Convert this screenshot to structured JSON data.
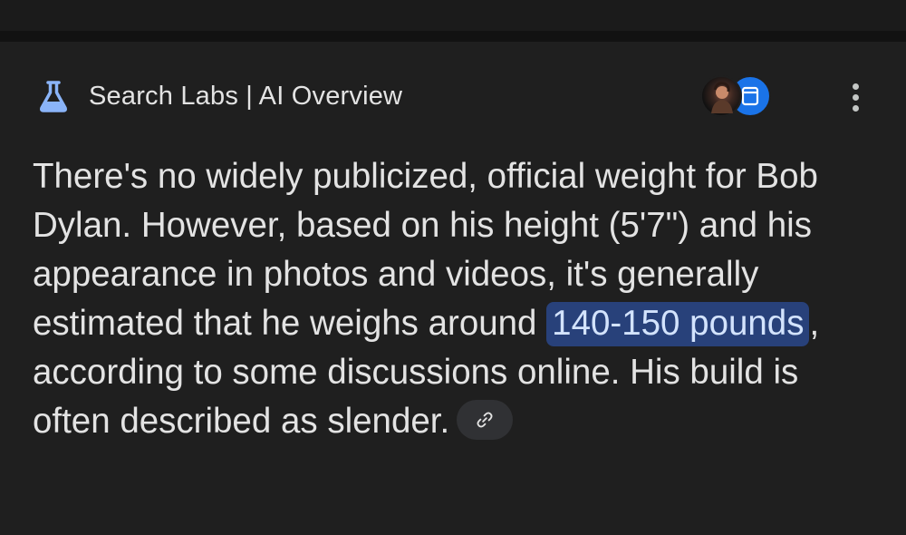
{
  "header": {
    "title": "Search Labs | AI Overview",
    "flask_icon": "flask-icon",
    "flask_color": "#8ab4f8"
  },
  "sources": {
    "items": [
      "source-avatar-photo",
      "source-app-icon"
    ],
    "app_color": "#1a73e8"
  },
  "menu": {
    "icon": "more-vert-icon"
  },
  "overview": {
    "text_before": "There's no widely publicized, official weight for Bob Dylan. However, based on his height (5'7\") and his appearance in photos and videos, it's generally estimated that he weighs around ",
    "highlight": "140-150 pounds",
    "text_after": ", according to some discussions online. His build is often described as slender.",
    "highlight_bg": "#28417a",
    "link_icon": "link-icon"
  }
}
